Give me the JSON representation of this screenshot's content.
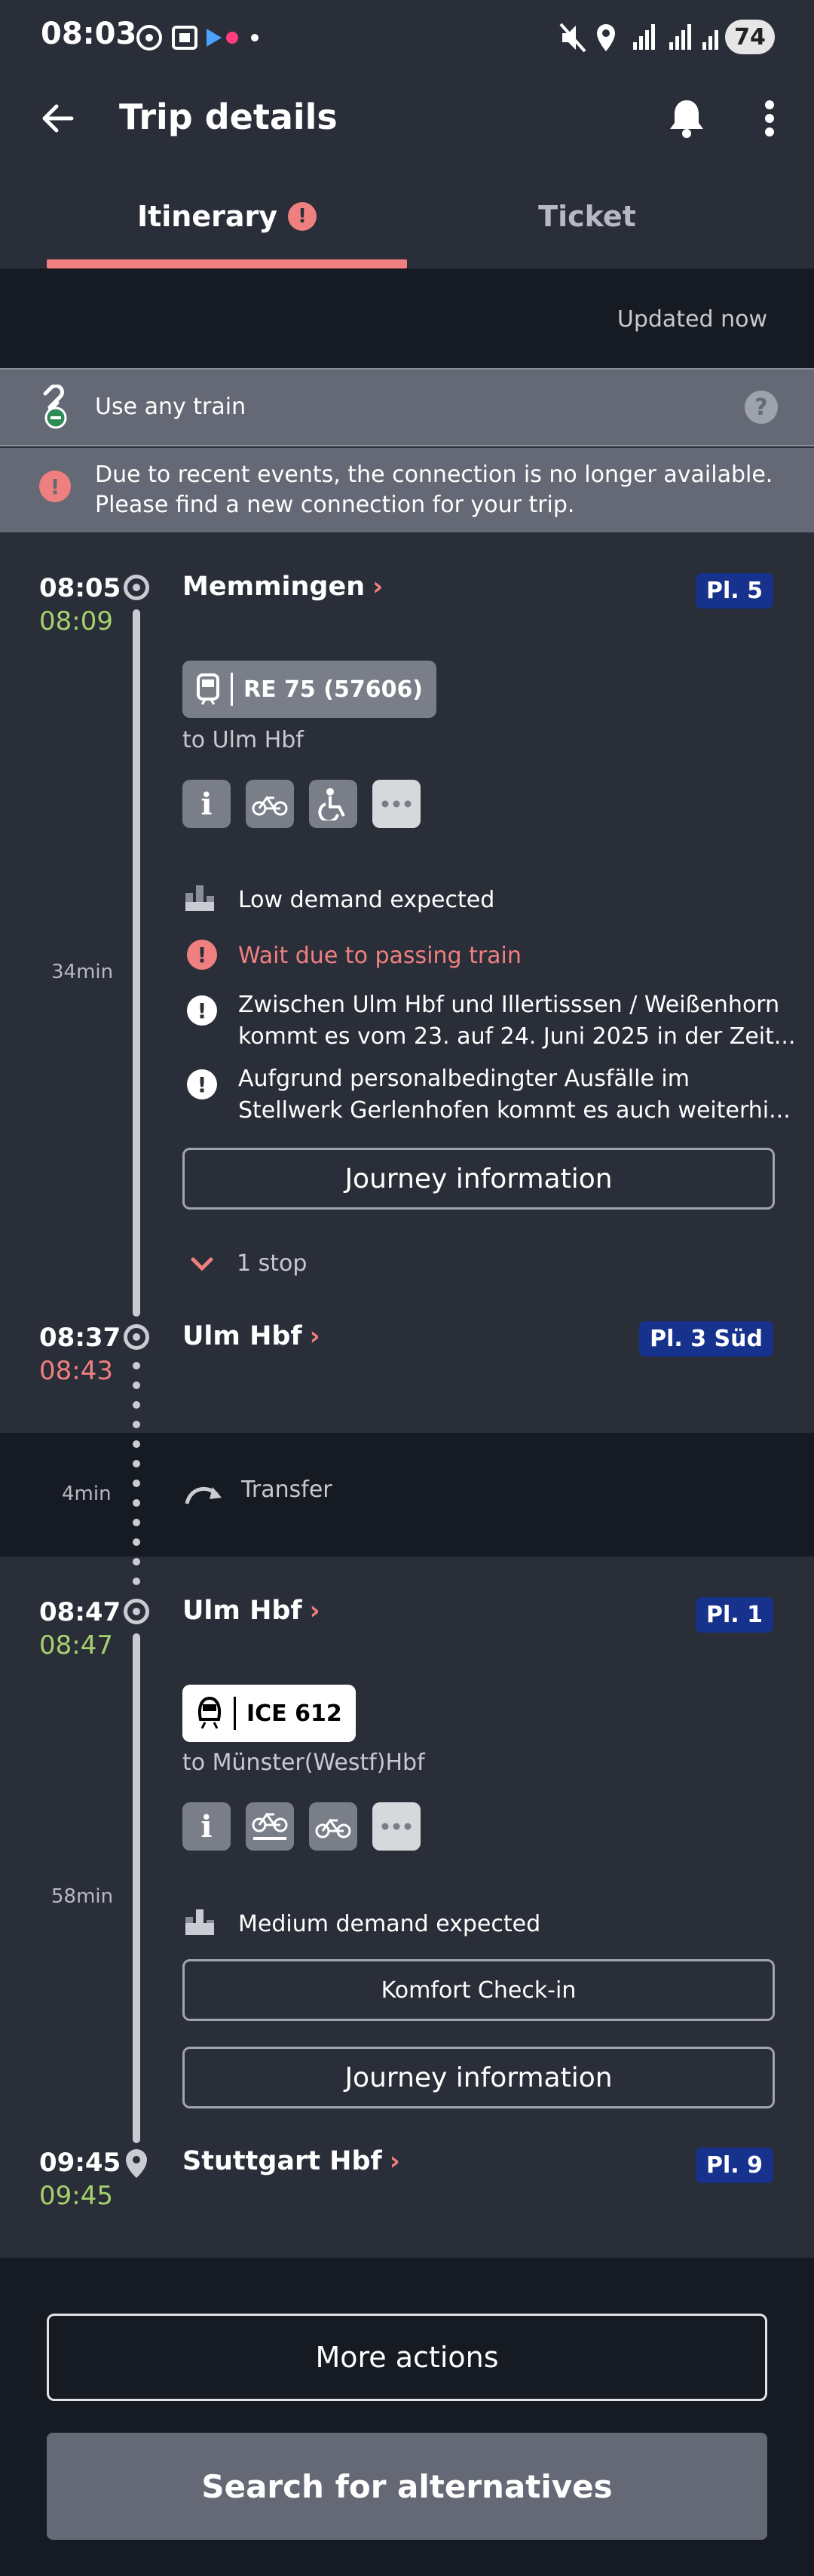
{
  "status_bar": {
    "time": "08:03",
    "battery": "74"
  },
  "appbar": {
    "title": "Trip details"
  },
  "tabs": [
    {
      "label": "Itinerary",
      "active": true
    },
    {
      "label": "Ticket",
      "active": false
    }
  ],
  "updated_text": "Updated now",
  "any_train": {
    "label": "Use any train"
  },
  "warning": {
    "line1": "Due to recent events, the connection is no longer available.",
    "line2": "Please find a new connection for your trip."
  },
  "leg1": {
    "dep_planned": "08:05",
    "dep_actual": "08:09",
    "station": "Memmingen",
    "platform": "Pl. 5",
    "train": "RE 75 (57606)",
    "direction": "to Ulm Hbf",
    "duration": "34min",
    "demand": "Low demand expected",
    "alert_red": "Wait due to passing train",
    "msg1_line1": "Zwischen Ulm Hbf und Illertisssen / Weißenhorn",
    "msg1_line2": "kommt es vom 23. auf 24. Juni 2025 in der Zeit...",
    "msg2_line1": "Aufgrund personalbedingter Ausfälle im",
    "msg2_line2": "Stellwerk Gerlenhofen kommt es auch weiterhi...",
    "journey_btn": "Journey information",
    "stops": "1 stop",
    "arr_planned": "08:37",
    "arr_actual": "08:43",
    "arr_station": "Ulm Hbf",
    "arr_platform": "Pl. 3 Süd"
  },
  "transfer": {
    "duration": "4min",
    "label": "Transfer"
  },
  "leg2": {
    "dep_planned": "08:47",
    "dep_actual": "08:47",
    "station": "Ulm Hbf",
    "platform": "Pl. 1",
    "train": "ICE 612",
    "direction": "to Münster(Westf)Hbf",
    "duration": "58min",
    "demand": "Medium demand expected",
    "checkin_btn": "Komfort Check-in",
    "journey_btn": "Journey information",
    "arr_planned": "09:45",
    "arr_actual": "09:45",
    "arr_station": "Stuttgart Hbf",
    "arr_platform": "Pl. 9"
  },
  "footer": {
    "more_actions": "More actions",
    "search_alternatives": "Search for alternatives"
  },
  "colors": {
    "accent": "#f08080",
    "on_time": "#a6d16f",
    "platform": "#16328c",
    "background": "#2a2e38"
  }
}
